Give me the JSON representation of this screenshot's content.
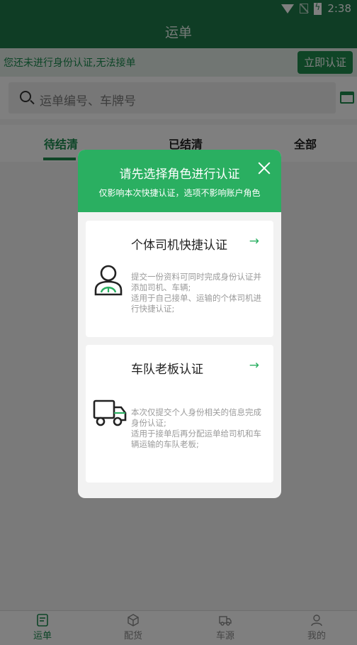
{
  "status_bar": {
    "time": "2:38"
  },
  "header": {
    "title": "运单"
  },
  "notice": {
    "text": "您还未进行身份认证,无法接单",
    "button": "立即认证"
  },
  "search": {
    "placeholder": "运单编号、车牌号"
  },
  "tabs": [
    {
      "label": "待结清",
      "active": true
    },
    {
      "label": "已结清",
      "active": false
    },
    {
      "label": "全部",
      "active": false
    }
  ],
  "bottom_nav": [
    {
      "label": "运单",
      "icon": "document-icon",
      "active": true
    },
    {
      "label": "配货",
      "icon": "box-icon",
      "active": false
    },
    {
      "label": "车源",
      "icon": "truck-icon",
      "active": false
    },
    {
      "label": "我的",
      "icon": "person-icon",
      "active": false
    }
  ],
  "modal": {
    "title": "请先选择角色进行认证",
    "subtitle": "仅影响本次快捷认证，选项不影响账户角色",
    "options": [
      {
        "title": "个体司机快捷认证",
        "description": "提交一份资料可同时完成身份认证并添加司机、车辆;\n适用于自己接单、运输的个体司机进行快捷认证;"
      },
      {
        "title": "车队老板认证",
        "description": "本次仅提交个人身份相关的信息完成身份认证;\n适用于接单后再分配运单给司机和车辆运输的车队老板;"
      }
    ]
  },
  "colors": {
    "primary": "#1f7b4a",
    "accent": "#2aaf61"
  }
}
